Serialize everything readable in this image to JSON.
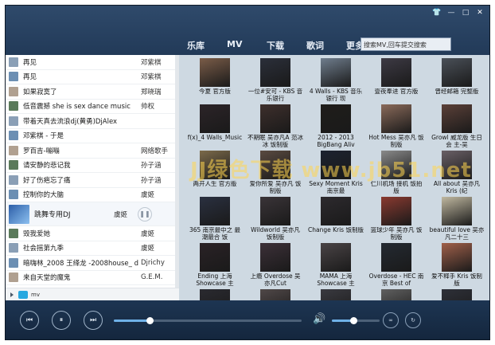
{
  "window_controls": {
    "skin": "👕",
    "min": "—",
    "max": "□",
    "close": "✕"
  },
  "nav": [
    {
      "label": "乐库"
    },
    {
      "label": "MV"
    },
    {
      "label": "下载"
    },
    {
      "label": "歌词"
    },
    {
      "label": "更多"
    }
  ],
  "search": {
    "placeholder": "搜索MV,回车提交搜索"
  },
  "playlist": [
    {
      "title": "再见",
      "artist": "邓紫棋"
    },
    {
      "title": "再见",
      "artist": "邓紫棋"
    },
    {
      "title": "如果寂寞了",
      "artist": "郑晓瑞"
    },
    {
      "title": "低音震撼 she is sex dance music",
      "artist": "帅权"
    },
    {
      "title": "带着天真去流浪dj(黄勇)DjAlex",
      "artist": ""
    },
    {
      "title": "邓紫棋 - 于是",
      "artist": ""
    },
    {
      "title": "罗百吉-嘣嘣",
      "artist": "网络歌手"
    },
    {
      "title": "请安静的悲记我",
      "artist": "孙子涵"
    },
    {
      "title": "好了伤疤忘了痛",
      "artist": "孙子涵"
    },
    {
      "title": "控制你的大脑",
      "artist": "虞姬"
    },
    {
      "title": "跳舞专用DJ",
      "artist": "虞姬",
      "active": true
    },
    {
      "title": "毁我爱她",
      "artist": "虞姬"
    },
    {
      "title": "社会摇第九季",
      "artist": "虞姬"
    },
    {
      "title": "暗嗨林_2008 王绎龙 -2008house_ d",
      "artist": "Djrichy"
    },
    {
      "title": "来自天堂的魔鬼",
      "artist": "G.E.M."
    }
  ],
  "mv_section": {
    "label": "mv"
  },
  "mv_grid": [
    {
      "text": "今夏 官方版",
      "color": "#7a5c48"
    },
    {
      "text": "一位#安可 - KBS 音乐银行",
      "color": "#2b2f3a"
    },
    {
      "text": "4 Walls - KBS 音乐银行 现",
      "color": "#6f7d8d"
    },
    {
      "text": "壹夜奉进 官方版",
      "color": "#3d3a44"
    },
    {
      "text": "曾经邮箱 完整版",
      "color": "#4a5058"
    },
    {
      "text": "f(x)_4 Walls_Music",
      "color": "#2c2428"
    },
    {
      "text": "不期眠 吴亦凡A 范冰冰 饭制版",
      "color": "#3e2f2c"
    },
    {
      "text": "2012 - 2013 BigBang Aliv",
      "color": "#1f1d1a"
    },
    {
      "text": "Hot Mess 吴亦凡 饭制版",
      "color": "#8a6a5a"
    },
    {
      "text": "Growl 威龙版 生日会 主-吴",
      "color": "#5b4038"
    },
    {
      "text": "两开人生 官方版",
      "color": "#7c6a4a"
    },
    {
      "text": "爱你所爱 吴亦凡 饭制版",
      "color": "#5a4a40"
    },
    {
      "text": "Sexy Moment Kris 南京最",
      "color": "#1c2230"
    },
    {
      "text": "仁川机场 接机 饭拍版",
      "color": "#8a8a8a"
    },
    {
      "text": "All about 吴亦凡Kris (纪",
      "color": "#6a6066"
    },
    {
      "text": "365 南京最中之 最潮最合 饭",
      "color": "#2a3040"
    },
    {
      "text": "Wildworld 吴亦凡 饭制版",
      "color": "#3a3438"
    },
    {
      "text": "Change Kris 饭制版",
      "color": "#2d2a2e"
    },
    {
      "text": "篮球少年 吴亦凡 饭制版",
      "color": "#8a3a30"
    },
    {
      "text": "beautiful love 吴亦凡二十三",
      "color": "#c0b8a0"
    },
    {
      "text": "Ending 上海 Showcase 主",
      "color": "#2a2226"
    },
    {
      "text": "上瘾 Overdose 吴亦凡Cut",
      "color": "#3c3038"
    },
    {
      "text": "MAMA 上海 Showcase 主",
      "color": "#4a4446"
    },
    {
      "text": "Overdose - HEC 南京 Best of",
      "color": "#242a32"
    },
    {
      "text": "爱不释手 Kris 饭制版",
      "color": "#a0604a"
    },
    {
      "text": "",
      "color": "#2a2a30"
    },
    {
      "text": "",
      "color": "#504848"
    },
    {
      "text": "",
      "color": "#3a3a40"
    },
    {
      "text": "",
      "color": "#606060"
    },
    {
      "text": "",
      "color": "#2e3038"
    }
  ],
  "player": {
    "prev": "⏮",
    "pause": "⏸",
    "next": "⏭",
    "volume": "🔊",
    "progress": 0.19,
    "volume_level": 0.45,
    "mode_btn": "∞",
    "loop_btn": "↻"
  },
  "watermark": "JJ绿色下载 www.jb51.net"
}
